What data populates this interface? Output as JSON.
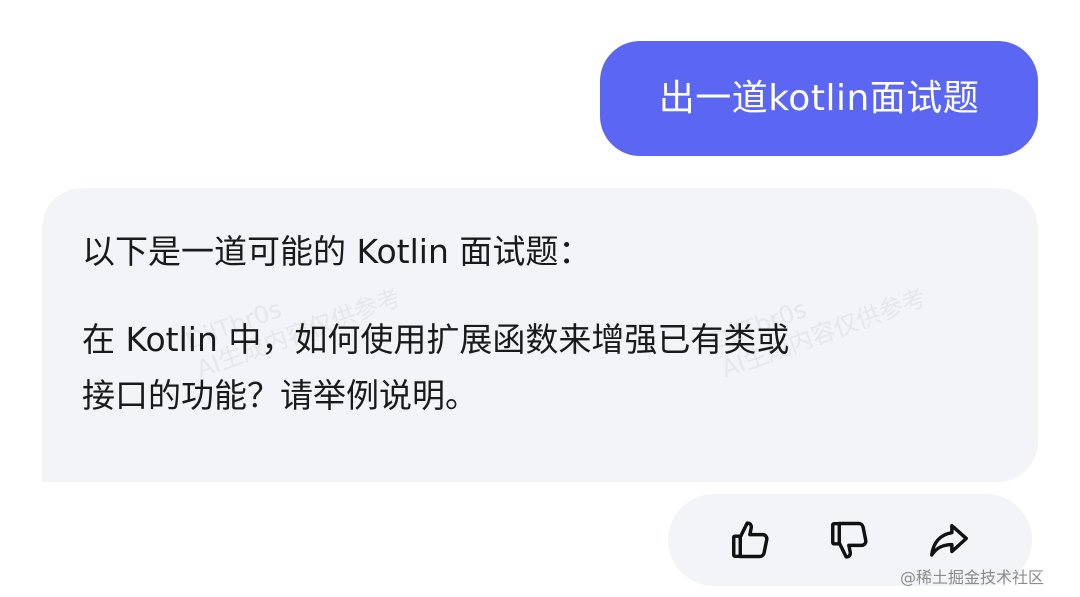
{
  "conversation": {
    "user_message": "出一道kotlin面试题",
    "assistant_message": {
      "intro": "以下是一道可能的 Kotlin 面试题：",
      "question_lines": [
        "在 Kotlin 中，如何使用扩展函数来增强已有类或",
        "接口的功能？请举例说明。"
      ]
    },
    "watermark": {
      "line1": "DilTbr0s",
      "line2": "AI生成内容仅供参考"
    }
  },
  "actions": {
    "like_icon": "thumbs-up-icon",
    "dislike_icon": "thumbs-down-icon",
    "share_icon": "share-icon"
  },
  "footer": {
    "watermark": "@稀土掘金技术社区"
  }
}
